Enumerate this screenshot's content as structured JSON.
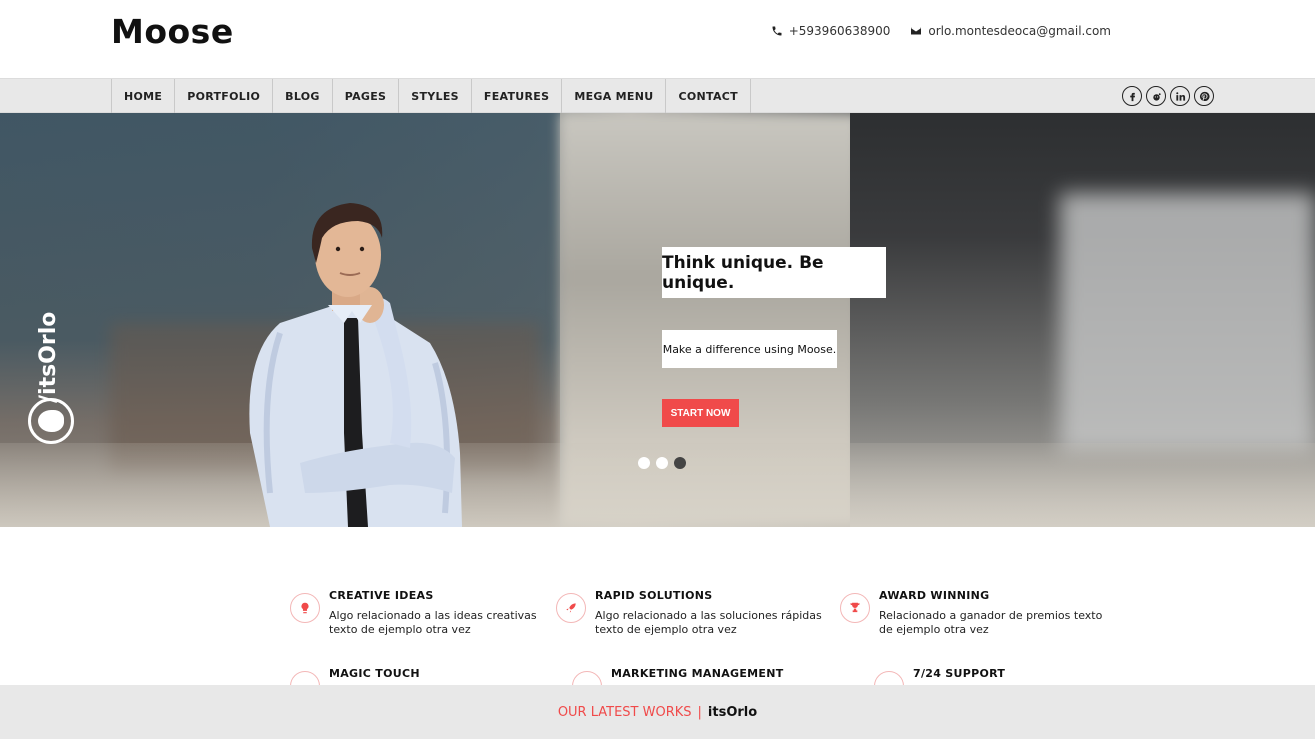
{
  "header": {
    "logo": "Moose",
    "phone": "+593960638900",
    "email": "orlo.montesdeoca@gmail.com"
  },
  "nav": {
    "items": [
      "HOME",
      "PORTFOLIO",
      "BLOG",
      "PAGES",
      "STYLES",
      "FEATURES",
      "MEGA MENU",
      "CONTACT"
    ],
    "socials": [
      "facebook-icon",
      "reddit-icon",
      "linkedin-icon",
      "pinterest-icon"
    ]
  },
  "hero": {
    "watermark": "/itsOrlo",
    "headline": "Think unique. Be unique.",
    "subline": "Make a difference using Moose.",
    "cta": "START NOW",
    "slides": 3,
    "active_slide": 2
  },
  "features": [
    {
      "title": "CREATIVE IDEAS",
      "desc": "Algo relacionado a las ideas creativas texto de ejemplo otra vez",
      "icon": "lightbulb-icon"
    },
    {
      "title": "RAPID SOLUTIONS",
      "desc": "Algo relacionado a las soluciones rápidas texto de ejemplo otra vez",
      "icon": "rocket-icon"
    },
    {
      "title": "AWARD WINNING",
      "desc": "Relacionado a ganador de premios texto de ejemplo otra vez",
      "icon": "trophy-icon"
    },
    {
      "title": "MAGIC TOUCH",
      "desc": "",
      "icon": "magic-icon"
    },
    {
      "title": "MARKETING MANAGEMENT",
      "desc": "",
      "icon": "chart-icon"
    },
    {
      "title": "7/24 SUPPORT",
      "desc": "",
      "icon": "support-icon"
    }
  ],
  "works": {
    "label": "OUR LATEST WORKS",
    "separator": "|",
    "brand": "itsOrlo"
  },
  "colors": {
    "accent": "#f04a4a",
    "nav_bg": "#e8e8e8"
  }
}
